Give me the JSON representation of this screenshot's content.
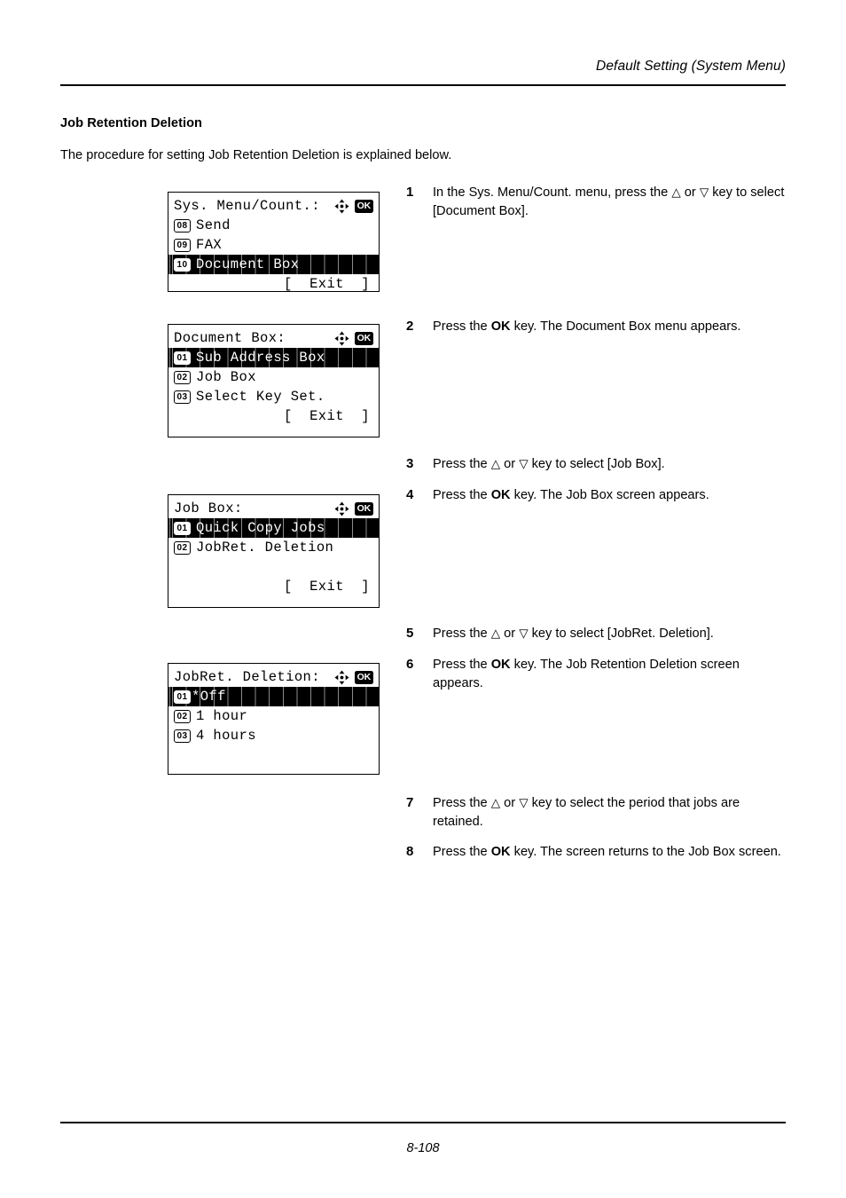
{
  "page": {
    "running_head": "Default Setting (System Menu)",
    "folio": "8-108",
    "section_title": "Job Retention Deletion",
    "intro": "The procedure for setting Job Retention Deletion is explained below."
  },
  "icons": {
    "arrows": "four-way-arrow-icon",
    "ok": "OK"
  },
  "panels": [
    {
      "id": "sys-menu-count",
      "header": "Sys. Menu/Count.:",
      "rows": [
        {
          "badge": "08",
          "label": "Send",
          "selected": false
        },
        {
          "badge": "09",
          "label": "FAX",
          "selected": false
        },
        {
          "badge": "10",
          "label": "Document Box",
          "selected": true
        }
      ],
      "footer": "[  Exit  ]"
    },
    {
      "id": "document-box",
      "header": "Document Box:",
      "rows": [
        {
          "badge": "01",
          "label": "Sub Address Box",
          "selected": true
        },
        {
          "badge": "02",
          "label": "Job Box",
          "selected": false
        },
        {
          "badge": "03",
          "label": "Select Key Set.",
          "selected": false
        }
      ],
      "footer": "[  Exit  ]"
    },
    {
      "id": "job-box",
      "header": "Job Box:",
      "rows": [
        {
          "badge": "01",
          "label": "Quick Copy Jobs",
          "selected": true
        },
        {
          "badge": "02",
          "label": "JobRet. Deletion",
          "selected": false
        },
        {
          "badge": "",
          "label": "",
          "selected": false
        }
      ],
      "footer": "[  Exit  ]"
    },
    {
      "id": "jobret-deletion",
      "header": "JobRet. Deletion:",
      "rows": [
        {
          "badge": "01",
          "label": "*Off",
          "selected": true,
          "tight": true
        },
        {
          "badge": "02",
          "label": "1 hour",
          "selected": false
        },
        {
          "badge": "03",
          "label": "4 hours",
          "selected": false
        }
      ],
      "footer": ""
    }
  ],
  "steps": [
    {
      "num": "1",
      "parts": [
        {
          "t": "In the Sys. Menu/Count. menu, press the "
        },
        {
          "t": "△",
          "tri": true
        },
        {
          "t": " or "
        },
        {
          "t": "▽",
          "tri": true
        },
        {
          "t": " key to select [Document Box]."
        }
      ]
    },
    {
      "num": "2",
      "parts": [
        {
          "t": "Press the "
        },
        {
          "t": "OK",
          "b": true
        },
        {
          "t": " key. The Document Box menu appears."
        }
      ]
    },
    {
      "num": "3",
      "parts": [
        {
          "t": "Press the "
        },
        {
          "t": "△",
          "tri": true
        },
        {
          "t": " or "
        },
        {
          "t": "▽",
          "tri": true
        },
        {
          "t": " key to select [Job Box]."
        }
      ]
    },
    {
      "num": "4",
      "parts": [
        {
          "t": "Press the "
        },
        {
          "t": "OK",
          "b": true
        },
        {
          "t": " key. The Job Box screen appears."
        }
      ]
    },
    {
      "num": "5",
      "parts": [
        {
          "t": "Press the "
        },
        {
          "t": "△",
          "tri": true
        },
        {
          "t": " or "
        },
        {
          "t": "▽",
          "tri": true
        },
        {
          "t": " key to select [JobRet. Deletion]."
        }
      ]
    },
    {
      "num": "6",
      "parts": [
        {
          "t": "Press the "
        },
        {
          "t": "OK",
          "b": true
        },
        {
          "t": " key. The Job Retention Deletion screen appears."
        }
      ]
    },
    {
      "num": "7",
      "parts": [
        {
          "t": "Press the "
        },
        {
          "t": "△",
          "tri": true
        },
        {
          "t": " or "
        },
        {
          "t": "▽",
          "tri": true
        },
        {
          "t": " key to select the period that jobs are retained."
        }
      ]
    },
    {
      "num": "8",
      "parts": [
        {
          "t": "Press the "
        },
        {
          "t": "OK",
          "b": true
        },
        {
          "t": " key. The screen returns to the Job Box screen."
        }
      ]
    }
  ]
}
